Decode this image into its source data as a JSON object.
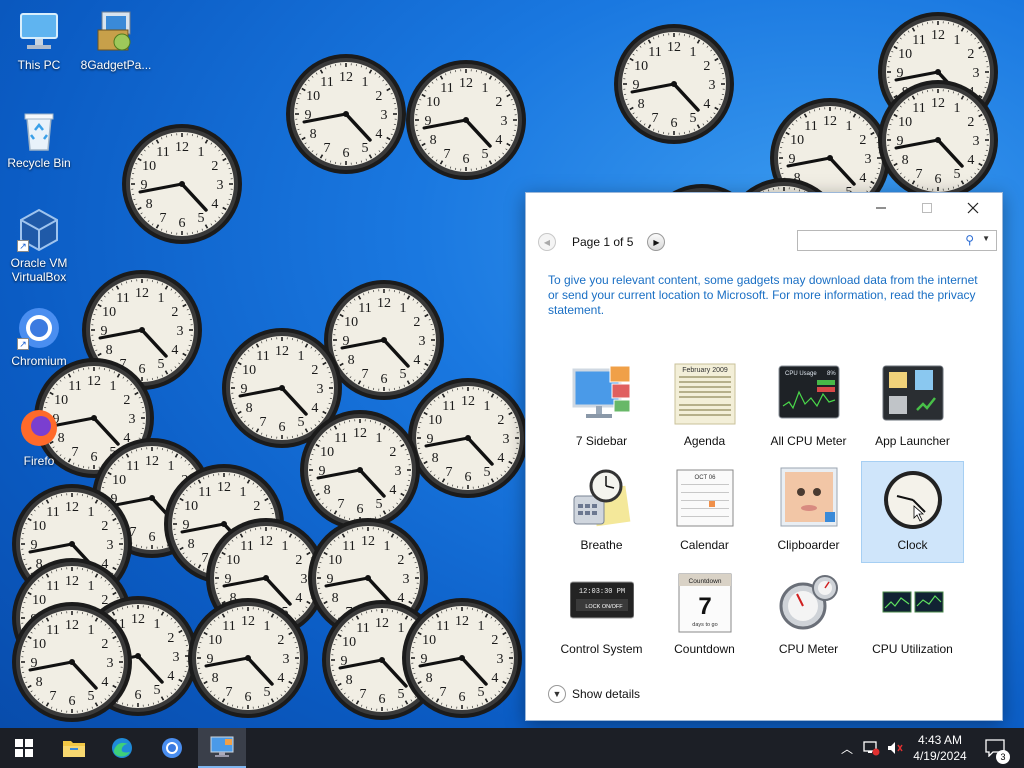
{
  "desktop": {
    "icons": [
      {
        "label": "This PC",
        "icon": "computer-icon"
      },
      {
        "label": "8GadgetPa...",
        "icon": "installer-icon"
      },
      {
        "label": "Recycle Bin",
        "icon": "recycle-bin-icon"
      },
      {
        "label": "Oracle VM VirtualBox",
        "icon": "virtualbox-icon"
      },
      {
        "label": "Chromium",
        "icon": "chromium-icon"
      },
      {
        "label": "Firefo",
        "icon": "firefox-icon"
      }
    ]
  },
  "window": {
    "controls": {
      "minimize": "─",
      "maximize": "☐",
      "close": "✕"
    },
    "nav": {
      "page_text": "Page 1 of 5",
      "prev_glyph": "◀",
      "next_glyph": "▶"
    },
    "search": {
      "placeholder": "",
      "icon_glyph": "⚲",
      "dropdown_glyph": "▼"
    },
    "info_text": "To give you relevant content, some gadgets may download data from the internet or send your current location to Microsoft. For more information, read the privacy statement.",
    "gadgets": [
      {
        "label": "7 Sidebar",
        "icon": "sidebar-gadget-icon",
        "selected": false
      },
      {
        "label": "Agenda",
        "icon": "agenda-gadget-icon",
        "selected": false
      },
      {
        "label": "All CPU Meter",
        "icon": "cpu-meter-gadget-icon",
        "selected": false
      },
      {
        "label": "App Launcher",
        "icon": "app-launcher-gadget-icon",
        "selected": false
      },
      {
        "label": "Breathe",
        "icon": "breathe-gadget-icon",
        "selected": false
      },
      {
        "label": "Calendar",
        "icon": "calendar-gadget-icon",
        "selected": false
      },
      {
        "label": "Clipboarder",
        "icon": "clipboarder-gadget-icon",
        "selected": false
      },
      {
        "label": "Clock",
        "icon": "clock-gadget-icon",
        "selected": true
      },
      {
        "label": "Control System",
        "icon": "control-system-gadget-icon",
        "selected": false
      },
      {
        "label": "Countdown",
        "icon": "countdown-gadget-icon",
        "selected": false
      },
      {
        "label": "CPU Meter",
        "icon": "cpu-gauge-gadget-icon",
        "selected": false
      },
      {
        "label": "CPU Utilization",
        "icon": "cpu-utilization-gadget-icon",
        "selected": false
      }
    ],
    "gadget_art": {
      "agenda_header": "February 2009",
      "cpu_usage_text": "CPU Usage",
      "cpu_usage_percent": "8%",
      "control_time": "12:03:30 PM",
      "control_lock": "LOCK ON/OFF",
      "countdown_header": "Countdown",
      "countdown_number": "7",
      "countdown_sub": "days to go",
      "calendar_header": "OCT 06"
    },
    "show_details": "Show details"
  },
  "taskbar": {
    "start_icon": "windows-start-icon",
    "pinned": [
      "file-explorer-icon",
      "edge-icon",
      "chromium-icon",
      "gadgets-icon"
    ],
    "time": "4:43 AM",
    "date": "4/19/2024",
    "notification_count": "3"
  }
}
